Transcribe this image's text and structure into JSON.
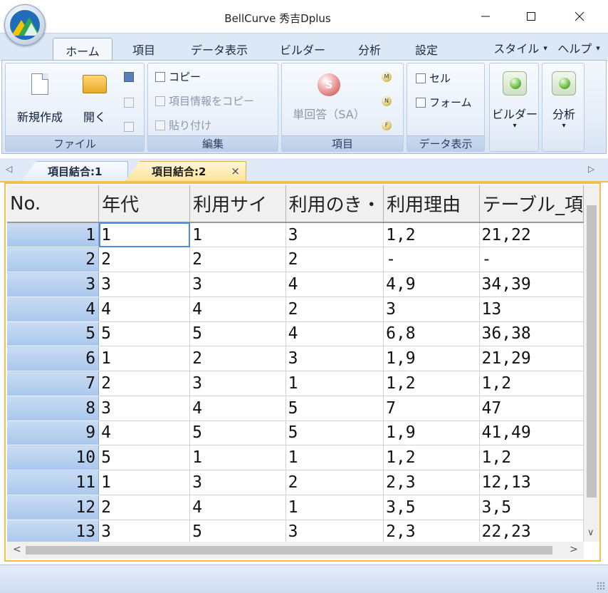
{
  "window": {
    "title": "BellCurve 秀吉Dplus",
    "minimize_icon": "minimize-icon",
    "maximize_icon": "maximize-icon",
    "close_icon": "close-icon"
  },
  "ribbon": {
    "tabs": [
      {
        "label": "ホーム",
        "active": true
      },
      {
        "label": "項目"
      },
      {
        "label": "データ表示"
      },
      {
        "label": "ビルダー"
      },
      {
        "label": "分析"
      },
      {
        "label": "設定"
      }
    ],
    "right_menus": [
      {
        "label": "スタイル",
        "arrow": "▾"
      },
      {
        "label": "ヘルプ",
        "arrow": "▾"
      }
    ],
    "groups": {
      "file": {
        "caption": "ファイル",
        "new_label": "新規作成",
        "open_label": "開く"
      },
      "edit": {
        "caption": "編集",
        "copy_label": "コピー",
        "copy_info_label": "項目情報をコピー",
        "paste_label": "貼り付け"
      },
      "item": {
        "caption": "項目",
        "single_answer_label": "単回答（SA）",
        "s_glyph": "S",
        "m_glyph": "M",
        "n_glyph": "N",
        "f_glyph": "F"
      },
      "data_view": {
        "caption": "データ表示",
        "cell_label": "セル",
        "form_label": "フォーム"
      },
      "builder": {
        "label": "ビルダー",
        "arrow": "▾"
      },
      "analysis": {
        "label": "分析",
        "arrow": "▾"
      }
    }
  },
  "doc_tabs": {
    "tabs": [
      {
        "label": "項目結合:1"
      },
      {
        "label": "項目結合:2",
        "active": true
      }
    ],
    "close_glyph": "×",
    "scroll_left": "◁",
    "scroll_right": "▷"
  },
  "grid": {
    "columns": [
      "No.",
      "年代",
      "利用サイ",
      "利用のき・",
      "利用理由",
      "テーブル_項"
    ],
    "rows": [
      [
        "1",
        "1",
        "1",
        "3",
        "1,2",
        "21,22"
      ],
      [
        "2",
        "2",
        "2",
        "2",
        "-",
        "-"
      ],
      [
        "3",
        "3",
        "3",
        "4",
        "4,9",
        "34,39"
      ],
      [
        "4",
        "4",
        "4",
        "2",
        "3",
        "13"
      ],
      [
        "5",
        "5",
        "5",
        "4",
        "6,8",
        "36,38"
      ],
      [
        "6",
        "1",
        "2",
        "3",
        "1,9",
        "21,29"
      ],
      [
        "7",
        "2",
        "3",
        "1",
        "1,2",
        "1,2"
      ],
      [
        "8",
        "3",
        "4",
        "5",
        "7",
        "47"
      ],
      [
        "9",
        "4",
        "5",
        "5",
        "1,9",
        "41,49"
      ],
      [
        "10",
        "5",
        "1",
        "1",
        "1,2",
        "1,2"
      ],
      [
        "11",
        "1",
        "3",
        "2",
        "2,3",
        "12,13"
      ],
      [
        "12",
        "2",
        "4",
        "1",
        "3,5",
        "3,5"
      ],
      [
        "13",
        "3",
        "5",
        "3",
        "2,3",
        "22,23"
      ]
    ],
    "scroll_left": "<",
    "scroll_right": ">",
    "scroll_down": "∨"
  }
}
